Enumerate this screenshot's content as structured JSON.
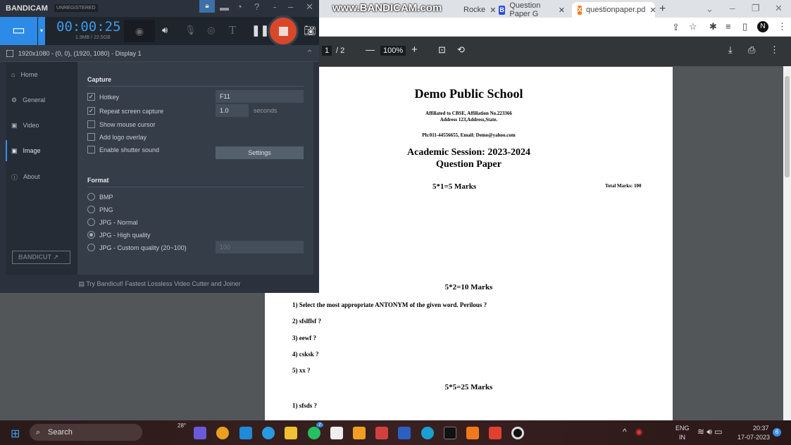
{
  "browser": {
    "tabs": [
      {
        "label": "Rocke"
      },
      {
        "label": "Question Paper G"
      },
      {
        "label": "questionpaper.pd"
      }
    ],
    "watermark": "www.BANDICAM.com",
    "new_tab": "+"
  },
  "pdf": {
    "page_current": "1",
    "page_total": "/ 2",
    "zoom": "100%",
    "school": "Demo Public School",
    "affiliation": "Affiliated to CBSE, Affiliation No.223366",
    "address": "Address 123,Address,State.",
    "contact": "Ph:011-44556655, Email: Demo@yahoo.com",
    "session": "Academic Session: 2023-2024",
    "doc_title": "Question Paper",
    "section1": "5*1=5 Marks",
    "total": "Total Marks: 100",
    "section2": "5*2=10 Marks",
    "questions2": [
      "1) Select the most appropriate ANTONYM of the given word. Perilous ?",
      "2) sfslflsf ?",
      "3) eewf ?",
      "4) csksk ?",
      "5) xx ?"
    ],
    "section3": "5*5=25 Marks",
    "questions3": [
      "1) sfsds ?"
    ]
  },
  "bandicam": {
    "logo": "BANDICAM",
    "badge": "UNREGISTERED",
    "timer": "00:00:25",
    "size": "1.9MB / 22.5GB",
    "region": "1920x1080 - (0, 0), (1920, 1080) - Display 1",
    "sidebar": [
      "Home",
      "General",
      "Video",
      "Image",
      "About"
    ],
    "bandicut": "BANDICUT",
    "capture_title": "Capture",
    "options": [
      {
        "label": "Hotkey",
        "checked": true
      },
      {
        "label": "Repeat screen capture",
        "checked": true
      },
      {
        "label": "Show mouse cursor",
        "checked": false
      },
      {
        "label": "Add logo overlay",
        "checked": false
      },
      {
        "label": "Enable shutter sound",
        "checked": false
      }
    ],
    "hotkey": "F11",
    "repeat": "1.0",
    "seconds": "seconds",
    "settings": "Settings",
    "format_title": "Format",
    "formats": [
      "BMP",
      "PNG",
      "JPG - Normal",
      "JPG - High quality",
      "JPG - Custom quality (20~100)"
    ],
    "selected_format": "JPG - High quality",
    "quality": "100",
    "footer": "Try Bandicut! Fastest Lossless Video Cutter and Joiner"
  },
  "taskbar": {
    "search": "Search",
    "weather": "28°",
    "lang": "ENG",
    "region": "IN",
    "time": "20:37",
    "date": "17-07-2023",
    "notif": "6",
    "whatsapp_badge": "7"
  }
}
